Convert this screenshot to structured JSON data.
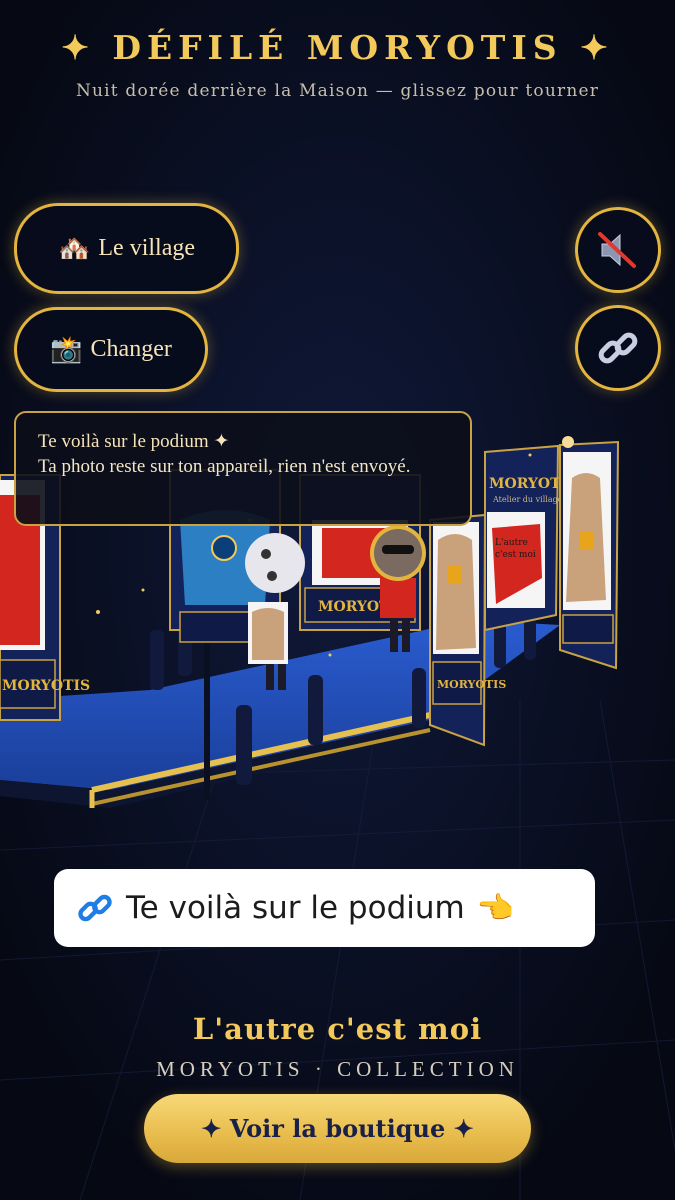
{
  "header": {
    "title": "✦ DÉFILÉ MORYOTIS ✦",
    "subtitle": "Nuit dorée derrière la Maison — glissez pour tourner"
  },
  "controls": {
    "village_icon": "🏘️",
    "village_label": "Le village",
    "change_icon": "📸",
    "change_label": "Changer",
    "sound_icon": "speaker-muted-icon",
    "share_icon": "link-icon"
  },
  "toast": {
    "title": "Te voilà sur le podium ✦",
    "message": "Ta photo reste sur ton appareil, rien n'est envoyé."
  },
  "scene": {
    "banner_brand": "MORYOTIS",
    "banner_sub": "Atelier du village",
    "shirt_text": "L'autre c'est moi"
  },
  "share_pill": {
    "label": "Te voilà sur le podium",
    "pointer": "👈"
  },
  "collection": {
    "title": "L'autre c'est moi",
    "subtitle": "MORYOTIS · COLLECTION",
    "shop_label": "✦ Voir la boutique ✦"
  },
  "colors": {
    "gold": "#e3b53e",
    "night": "#070b18",
    "runway_blue": "#1f4fb8",
    "shirt_red": "#d3261e",
    "hoodie_tan": "#c9a27c"
  }
}
